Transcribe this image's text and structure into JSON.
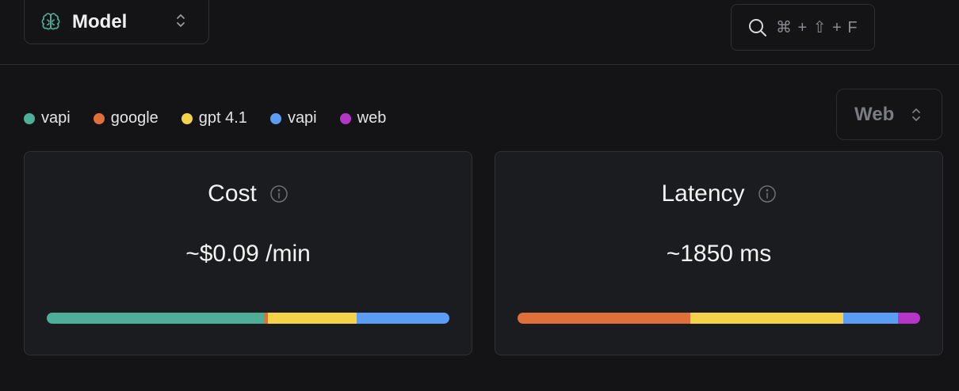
{
  "header": {
    "model_selector": {
      "label": "Model",
      "icon": "brain-icon"
    },
    "search": {
      "shortcut": "⌘ + ⇧ + F",
      "icon": "search-icon"
    }
  },
  "legend": [
    {
      "label": "vapi",
      "color": "#4fae98"
    },
    {
      "label": "google",
      "color": "#e0703a"
    },
    {
      "label": "gpt 4.1",
      "color": "#f4d34b"
    },
    {
      "label": "vapi",
      "color": "#5b9cf5"
    },
    {
      "label": "web",
      "color": "#b535c9"
    }
  ],
  "platform_selector": {
    "label": "Web"
  },
  "cards": {
    "cost": {
      "title": "Cost",
      "value": "~$0.09 /min",
      "breakdown": [
        {
          "color": "#4fae98",
          "fraction": 0.54
        },
        {
          "color": "#e0703a",
          "fraction": 0.01
        },
        {
          "color": "#f4d34b",
          "fraction": 0.22
        },
        {
          "color": "#5b9cf5",
          "fraction": 0.23
        }
      ]
    },
    "latency": {
      "title": "Latency",
      "value": "~1850 ms",
      "breakdown": [
        {
          "color": "#e0703a",
          "fraction": 0.43
        },
        {
          "color": "#f4d34b",
          "fraction": 0.38
        },
        {
          "color": "#5b9cf5",
          "fraction": 0.135
        },
        {
          "color": "#b535c9",
          "fraction": 0.055
        }
      ]
    }
  }
}
